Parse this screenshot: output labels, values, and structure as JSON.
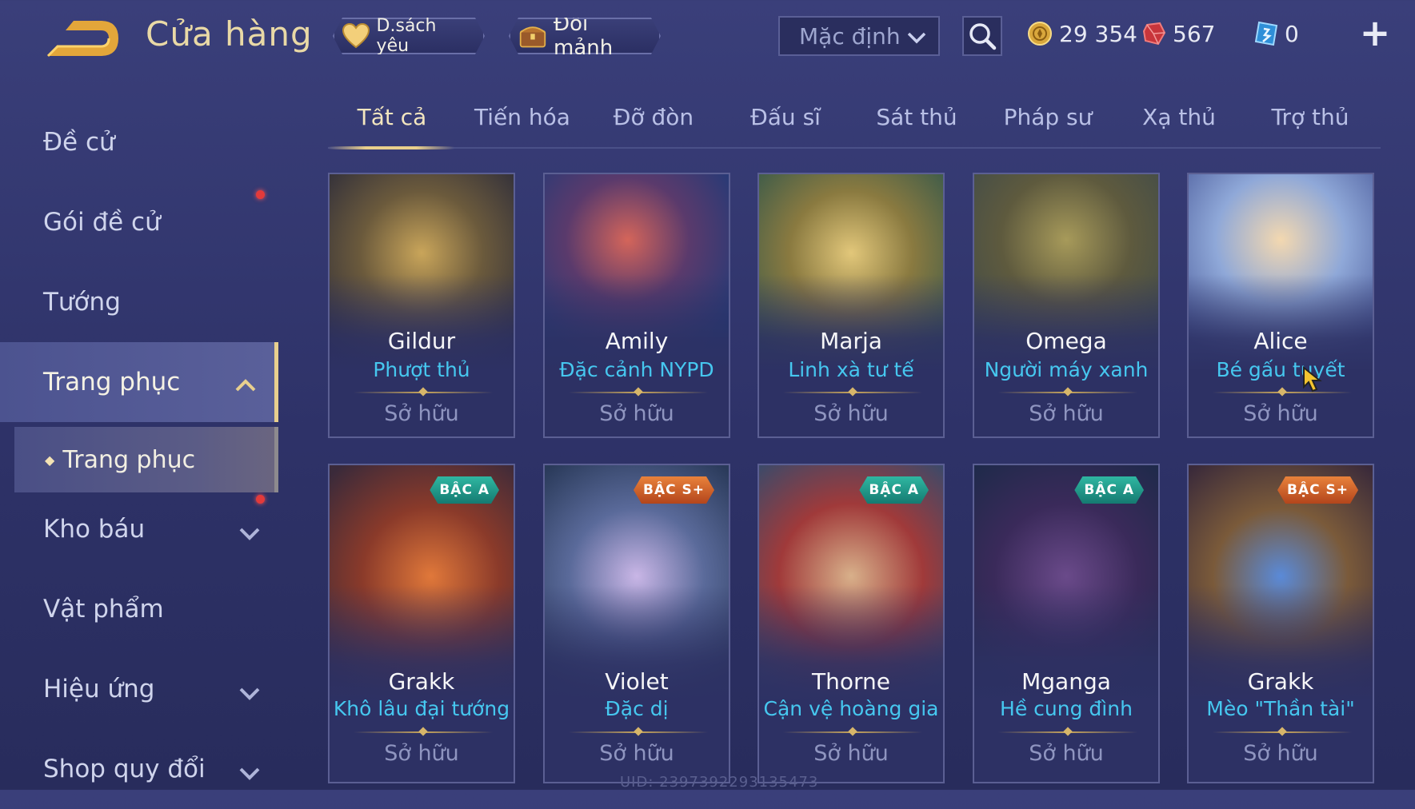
{
  "header": {
    "title": "Cửa hàng",
    "favorites_label": "D.sách yêu",
    "exchange_label": "Đổi mảnh",
    "sort_value": "Mặc định",
    "currencies": [
      {
        "icon": "gold-coin-icon",
        "value": "29 354"
      },
      {
        "icon": "ruby-icon",
        "value": "567"
      },
      {
        "icon": "voucher-icon",
        "value": "0"
      }
    ],
    "add_label": "+"
  },
  "sidebar": {
    "items": [
      {
        "label": "Đề cử"
      },
      {
        "label": "Gói đề cử"
      },
      {
        "label": "Tướng"
      },
      {
        "label": "Trang phục"
      },
      {
        "label": "Trang phục"
      },
      {
        "label": "Kho báu"
      },
      {
        "label": "Vật phẩm"
      },
      {
        "label": "Hiệu ứng"
      },
      {
        "label": "Shop quy đổi"
      }
    ]
  },
  "tabs": [
    "Tất cả",
    "Tiến hóa",
    "Đỡ đòn",
    "Đấu sĩ",
    "Sát thủ",
    "Pháp sư",
    "Xạ thủ",
    "Trợ thủ"
  ],
  "cards": [
    {
      "hero": "Gildur",
      "skin": "Phượt thủ",
      "status": "Sở hữu",
      "badge": ""
    },
    {
      "hero": "Amily",
      "skin": "Đặc cảnh NYPD",
      "status": "Sở hữu",
      "badge": ""
    },
    {
      "hero": "Marja",
      "skin": "Linh xà tư tế",
      "status": "Sở hữu",
      "badge": ""
    },
    {
      "hero": "Omega",
      "skin": "Người máy xanh",
      "status": "Sở hữu",
      "badge": ""
    },
    {
      "hero": "Alice",
      "skin": "Bé gấu tuyết",
      "status": "Sở hữu",
      "badge": ""
    },
    {
      "hero": "Grakk",
      "skin": "Khô lâu đại tướng",
      "status": "Sở hữu",
      "badge": "BẬC A"
    },
    {
      "hero": "Violet",
      "skin": "Đặc dị",
      "status": "Sở hữu",
      "badge": "BẬC S+"
    },
    {
      "hero": "Thorne",
      "skin": "Cận vệ hoàng gia",
      "status": "Sở hữu",
      "badge": "BẬC A"
    },
    {
      "hero": "Mganga",
      "skin": "Hề cung đình",
      "status": "Sở hữu",
      "badge": "BẬC A"
    },
    {
      "hero": "Grakk",
      "skin": "Mèo \"Thần tài\"",
      "status": "Sở hữu",
      "badge": "BẬC S+"
    }
  ],
  "uid": "UID: 2397392293135473",
  "colors": {
    "accent_gold": "#e8cf8e",
    "skin_name_blue": "#46c7ef",
    "badge_a": "#2fb7a2",
    "badge_splus": "#e9823b",
    "notification_red": "#e33a3a"
  }
}
